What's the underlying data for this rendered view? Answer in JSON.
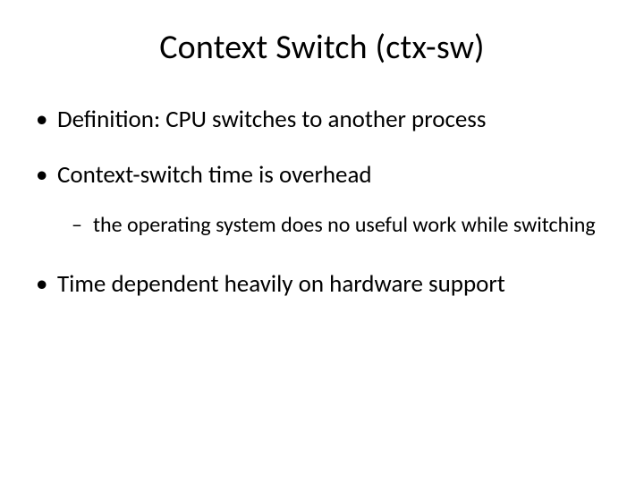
{
  "title": "Context Switch (ctx-sw)",
  "bullets": {
    "b1": "Definition: CPU switches to another process",
    "b2": "Context-switch time is overhead",
    "b2_sub1": "the operating system does no useful work while switching",
    "b3": "Time dependent heavily on hardware support"
  }
}
